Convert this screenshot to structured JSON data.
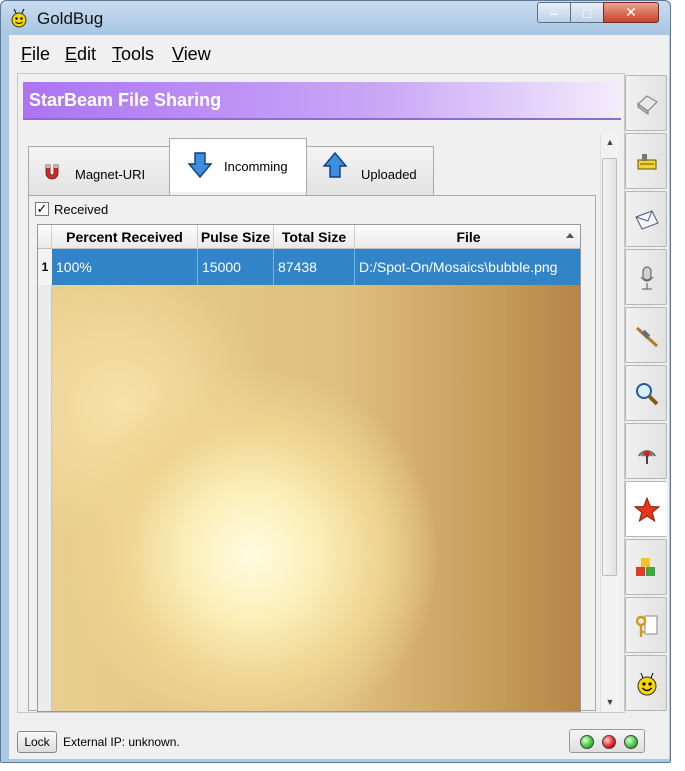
{
  "window": {
    "title": "GoldBug",
    "min_label": "–",
    "max_label": "□",
    "close_label": "✕"
  },
  "menu": [
    {
      "label": "File",
      "mnemonic": "F",
      "rest": "ile"
    },
    {
      "label": "Edit",
      "mnemonic": "E",
      "rest": "dit"
    },
    {
      "label": "Tools",
      "mnemonic": "T",
      "rest": "ools"
    },
    {
      "label": "View",
      "mnemonic": "V",
      "rest": "iew"
    }
  ],
  "banner": {
    "title": "StarBeam File Sharing"
  },
  "tabs": [
    {
      "label": "Magnet-URI",
      "icon": "magnet-icon",
      "active": false
    },
    {
      "label": "Incomming",
      "icon": "arrow-down-icon",
      "active": true
    },
    {
      "label": "Uploaded",
      "icon": "arrow-up-icon",
      "active": false
    }
  ],
  "received_checkbox": {
    "label": "Received",
    "checked": true,
    "mark": "✓"
  },
  "table": {
    "columns": [
      "Percent Received",
      "Pulse Size",
      "Total Size",
      "File"
    ],
    "sort_column": "File",
    "rows": [
      {
        "num": "1",
        "cells": [
          "100%",
          "15000",
          "87438",
          "D:/Spot-On/Mosaics\\bubble.png"
        ]
      }
    ]
  },
  "scrollbar": {
    "up": "▲",
    "down": "▼"
  },
  "sidebar": [
    {
      "icon": "eraser-icon",
      "active": false
    },
    {
      "icon": "buzz-chat-icon",
      "active": false
    },
    {
      "icon": "mail-icon",
      "active": false
    },
    {
      "icon": "microphone-icon",
      "active": false
    },
    {
      "icon": "cable-plug-icon",
      "active": false
    },
    {
      "icon": "magnifier-icon",
      "active": false
    },
    {
      "icon": "listener-signal-icon",
      "active": false
    },
    {
      "icon": "starbeam-star-icon",
      "active": true
    },
    {
      "icon": "cubes-icon",
      "active": false
    },
    {
      "icon": "key-icon",
      "active": false
    },
    {
      "icon": "goldbug-smiley-icon",
      "active": false
    }
  ],
  "status": {
    "lock_label": "Lock",
    "text": "External IP: unknown.",
    "leds": [
      "green",
      "red",
      "green"
    ]
  },
  "colors": {
    "selection": "#3284c9",
    "banner_start": "#ad74f3",
    "active_star": "#e8351e"
  }
}
